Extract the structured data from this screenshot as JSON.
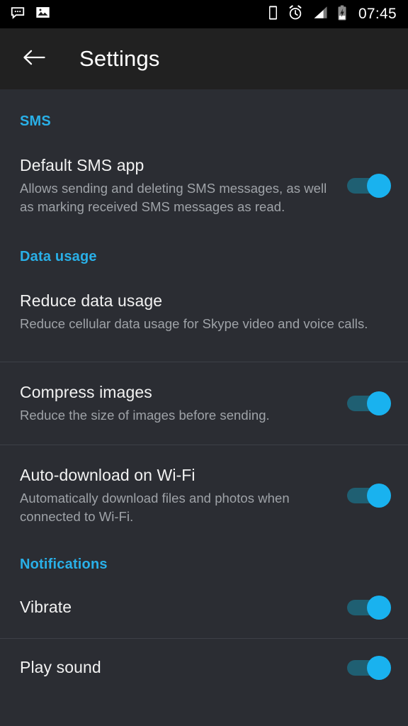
{
  "status_bar": {
    "left_icons": [
      {
        "name": "messages-icon",
        "label": "Messages notification"
      },
      {
        "name": "photo-icon",
        "label": "Screenshot / image notification"
      }
    ],
    "right_icons": [
      {
        "name": "phone-vibrate-icon",
        "label": "Phone"
      },
      {
        "name": "alarm-clock-icon",
        "label": "Alarm set"
      },
      {
        "name": "signal-bars-icon",
        "label": "Cellular signal"
      },
      {
        "name": "battery-charging-icon",
        "label": "Battery charging"
      }
    ],
    "clock": "07:45"
  },
  "app_bar": {
    "back_icon": "back-arrow-icon",
    "title": "Settings"
  },
  "colors": {
    "accent": "#29b0e8",
    "toggle_on_thumb": "#19b2ef",
    "toggle_on_track": "#1f5f72",
    "status_bar_bg": "#000000",
    "app_bar_bg": "#212121",
    "content_bg": "#2b2d33",
    "divider": "#3d4047",
    "title_text": "#f2f2f2",
    "sub_text": "#9fa3a8"
  },
  "sections": [
    {
      "header": "SMS",
      "rows": [
        {
          "title": "Default SMS app",
          "subtitle": "Allows sending and deleting SMS messages, as well as marking received SMS messages as read.",
          "toggle": {
            "present": true,
            "state": "on"
          }
        }
      ]
    },
    {
      "header": "Data usage",
      "rows": [
        {
          "title": "Reduce data usage",
          "subtitle": "Reduce cellular data usage for Skype video and voice calls.",
          "toggle": {
            "present": false,
            "state": ""
          }
        },
        {
          "title": "Compress images",
          "subtitle": "Reduce the size of images before sending.",
          "toggle": {
            "present": true,
            "state": "on"
          }
        },
        {
          "title": "Auto-download on Wi-Fi",
          "subtitle": "Automatically download files and photos when connected to Wi-Fi.",
          "toggle": {
            "present": true,
            "state": "on"
          }
        }
      ]
    },
    {
      "header": "Notifications",
      "rows": [
        {
          "title": "Vibrate",
          "subtitle": "",
          "toggle": {
            "present": true,
            "state": "on"
          }
        },
        {
          "title": "Play sound",
          "subtitle": "",
          "toggle": {
            "present": true,
            "state": "on"
          }
        }
      ]
    }
  ]
}
